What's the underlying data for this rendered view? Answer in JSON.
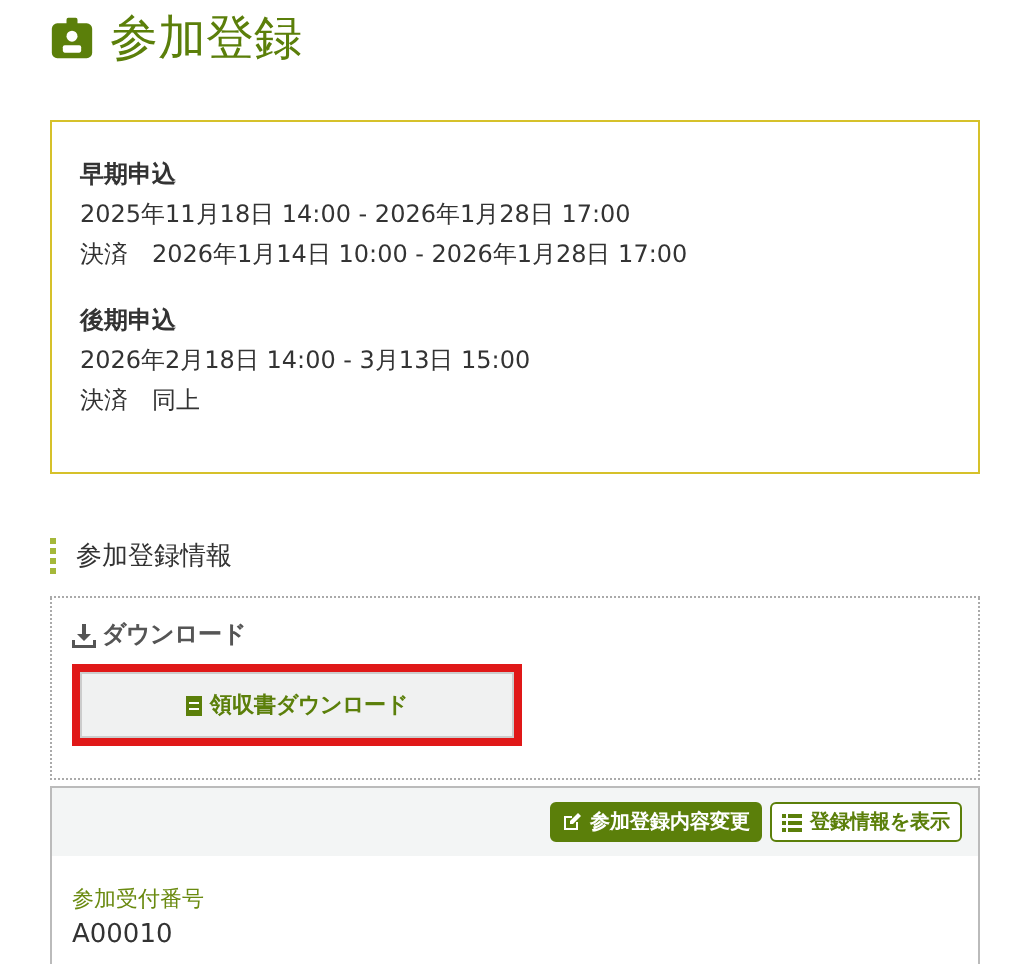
{
  "title": "参加登録",
  "periods": [
    {
      "heading": "早期申込",
      "lines": [
        "2025年11月18日 14:00 - 2026年1月28日 17:00",
        "決済　2026年1月14日 10:00 - 2026年1月28日 17:00"
      ]
    },
    {
      "heading": "後期申込",
      "lines": [
        "2026年2月18日 14:00 - 3月13日 15:00",
        "決済　同上"
      ]
    }
  ],
  "section_heading": "参加登録情報",
  "download": {
    "heading": "ダウンロード",
    "button": "領収書ダウンロード"
  },
  "card": {
    "buttons": [
      {
        "label": "参加登録内容変更",
        "kind": "primary"
      },
      {
        "label": "登録情報を表示",
        "kind": "outline"
      }
    ],
    "field_label": "参加受付番号",
    "field_value": "A00010"
  }
}
